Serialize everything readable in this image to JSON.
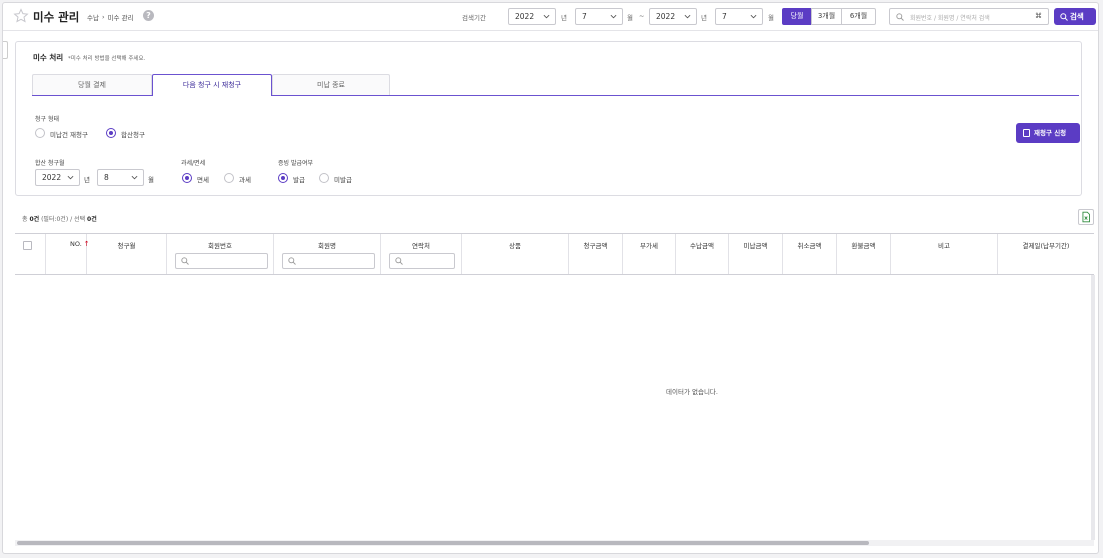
{
  "header": {
    "title": "미수 관리",
    "breadcrumb": [
      "수납",
      "미수 관리"
    ],
    "period_label": "검색기간",
    "start_year": "2022",
    "start_year_unit": "년",
    "start_month": "7",
    "start_month_unit": "월",
    "range_sep": "~",
    "end_year": "2022",
    "end_year_unit": "년",
    "end_month": "7",
    "end_month_unit": "월",
    "quick_ranges": [
      "당월",
      "3개월",
      "6개월"
    ],
    "search_placeholder": "회원번호 / 회원명 / 연락처 검색",
    "search_kbd": "⌘",
    "search_button": "검색"
  },
  "panel": {
    "title": "미수 처리",
    "description": "*미수 처리 방법을 선택해 주세요.",
    "tabs": [
      "당월 결제",
      "다음 청구 시 재청구",
      "미납 종료"
    ],
    "billing_type": {
      "label": "청구 형태",
      "options": [
        "미납건 재청구",
        "합산청구"
      ],
      "selected": "합산청구"
    },
    "combined_month": {
      "label": "합산 청구월",
      "year": "2022",
      "year_unit": "년",
      "month": "8",
      "month_unit": "월"
    },
    "tax": {
      "label": "과세/면세",
      "options": [
        "면세",
        "과세"
      ],
      "selected": "면세"
    },
    "receipt": {
      "label": "증빙 발급여부",
      "options": [
        "발급",
        "미발급"
      ],
      "selected": "발급"
    },
    "rebill_button": "재청구 신청"
  },
  "summary": {
    "total_prefix": "총",
    "total_count": "0건",
    "total_suffix": "(필터:0건)",
    "sep": "/",
    "selected_prefix": "선택",
    "selected_count": "0건"
  },
  "table": {
    "columns": [
      "NO.",
      "청구월",
      "회원번호",
      "회원명",
      "연락처",
      "상품",
      "청구금액",
      "부가세",
      "수납금액",
      "미납금액",
      "취소금액",
      "환불금액",
      "비고",
      "결제일(납부기간)"
    ],
    "empty_message": "데이터가 없습니다."
  },
  "colors": {
    "accent": "#5b3cc4",
    "required": "#d0021b"
  }
}
